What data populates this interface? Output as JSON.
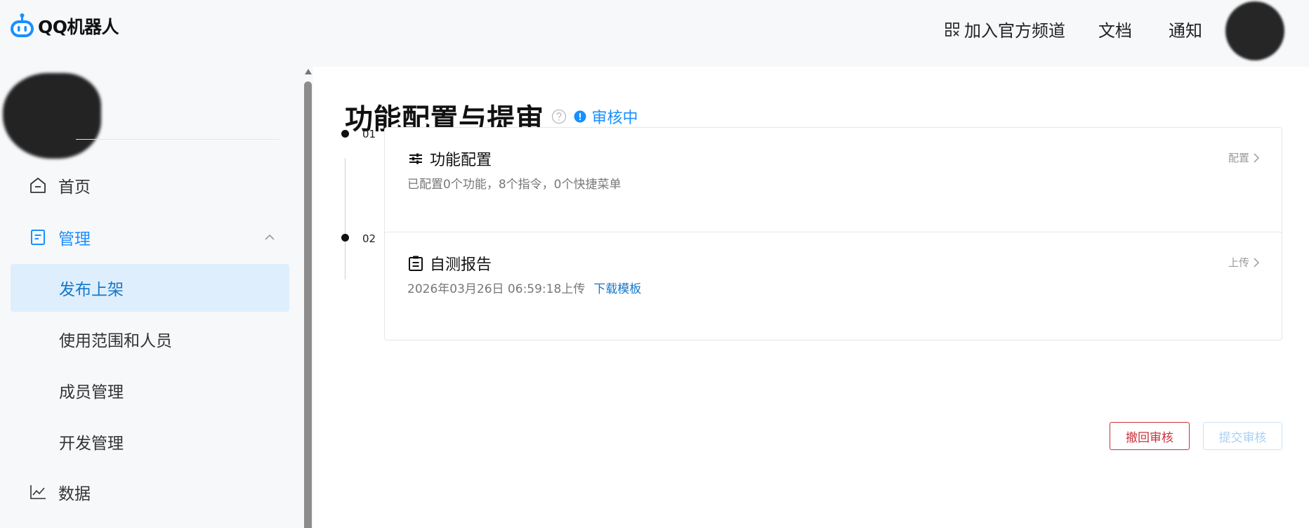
{
  "brand": {
    "name": "QQ机器人",
    "color": "#1890ff"
  },
  "header": {
    "channel_label": "加入官方频道",
    "docs_label": "文档",
    "notify_label": "通知",
    "channel_icon": "qr-code-icon"
  },
  "sidebar": {
    "items": [
      {
        "label": "首页",
        "icon": "home-icon"
      },
      {
        "label": "管理",
        "icon": "manage-icon",
        "expanded": true
      },
      {
        "label": "发布上架",
        "selected": true
      },
      {
        "label": "使用范围和人员"
      },
      {
        "label": "成员管理"
      },
      {
        "label": "开发管理"
      },
      {
        "label": "数据",
        "icon": "chart-line-icon"
      }
    ]
  },
  "main": {
    "title": "功能配置与提审",
    "status": "审核中",
    "steps": [
      {
        "number": "01",
        "title": "功能配置",
        "subtitle": "已配置0个功能，8个指令，0个快捷菜单",
        "action": "配置"
      },
      {
        "number": "02",
        "title": "自测报告",
        "subtitle": "2026年03月26日 06:59:18上传",
        "link": "下载模板",
        "action": "上传"
      }
    ],
    "buttons": {
      "withdraw": "撤回审核",
      "submit": "提交审核"
    }
  },
  "colors": {
    "accent": "#1890ff",
    "selected_bg": "#deeefd",
    "danger": "#c9313d",
    "disabled_text": "#a8d1f3"
  }
}
